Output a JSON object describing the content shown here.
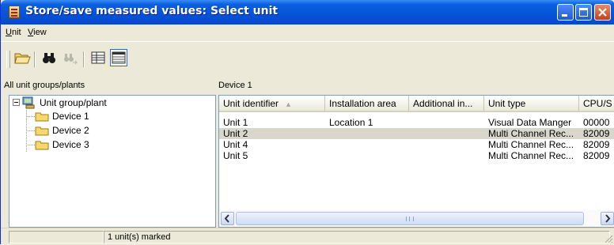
{
  "window": {
    "title": "Store/save measured values: Select unit",
    "title_bar_color": "#0553d8",
    "buttons": [
      "minimize-icon",
      "maximize-icon",
      "close-icon"
    ]
  },
  "menu": {
    "items": [
      {
        "label": "Unit",
        "accel": "U",
        "rest": "nit"
      },
      {
        "label": "View",
        "accel": "V",
        "rest": "iew"
      }
    ]
  },
  "toolbar": {
    "icons": [
      "open-folder-icon",
      "binoculars-find-icon",
      "find-next-icon",
      "details-view-icon",
      "list-view-icon"
    ]
  },
  "left_pane": {
    "header": "All unit groups/plants",
    "tree": {
      "root": "Unit group/plant",
      "children": [
        "Device 1",
        "Device 2",
        "Device 3"
      ]
    }
  },
  "right_pane": {
    "header": "Device 1",
    "columns": [
      "Unit identifier",
      "Installation area",
      "Additional in...",
      "Unit type",
      "CPU/S"
    ],
    "rows": [
      [
        "Unit 1",
        "Location 1",
        "",
        "Visual Data Manger",
        "00000"
      ],
      [
        "Unit 2",
        "",
        "",
        "Multi Channel Rec...",
        "82009"
      ],
      [
        "Unit 4",
        "",
        "",
        "Multi Channel Rec...",
        "82009"
      ],
      [
        "Unit 5",
        "",
        "",
        "Multi Channel Rec...",
        "82009"
      ]
    ],
    "selected_row": 1,
    "selected_color": "#d9d6cb"
  },
  "status": {
    "marked": "1 unit(s) marked"
  }
}
